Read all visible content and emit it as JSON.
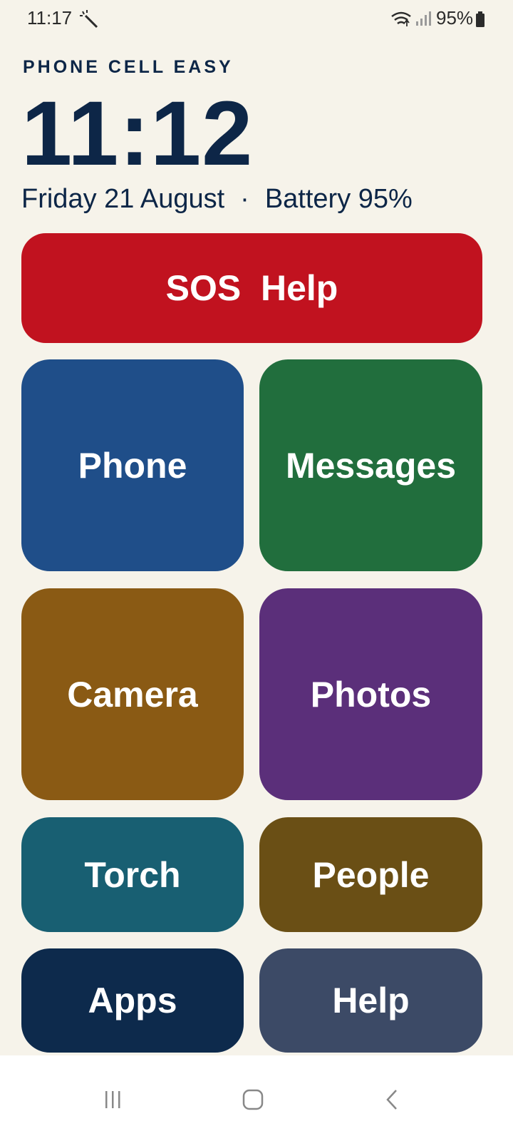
{
  "status_bar": {
    "time": "11:17",
    "battery_text": "95%",
    "icons": [
      "magic-wand-icon",
      "wifi-icon",
      "signal-icon",
      "battery-icon"
    ]
  },
  "header": {
    "app_title": "PHONE CELL EASY",
    "clock": "11:12",
    "date": "Friday 21 August",
    "separator": "·",
    "battery_label": "Battery 95%"
  },
  "tiles": {
    "sos": {
      "label": "SOS  Help",
      "color": "#c1121f"
    },
    "phone": {
      "label": "Phone",
      "color": "#1f4e89"
    },
    "messages": {
      "label": "Messages",
      "color": "#216e3d"
    },
    "camera": {
      "label": "Camera",
      "color": "#8a5a14"
    },
    "photos": {
      "label": "Photos",
      "color": "#5b2f7a"
    },
    "torch": {
      "label": "Torch",
      "color": "#185f72"
    },
    "people": {
      "label": "People",
      "color": "#6a4f15"
    },
    "apps": {
      "label": "Apps",
      "color": "#0d2a4c"
    },
    "help": {
      "label": "Help",
      "color": "#3c4a66"
    }
  },
  "nav_bar": {
    "buttons": [
      "recents-icon",
      "home-icon",
      "back-icon"
    ]
  },
  "colors": {
    "background": "#f6f3ea",
    "text": "#0d2647"
  }
}
